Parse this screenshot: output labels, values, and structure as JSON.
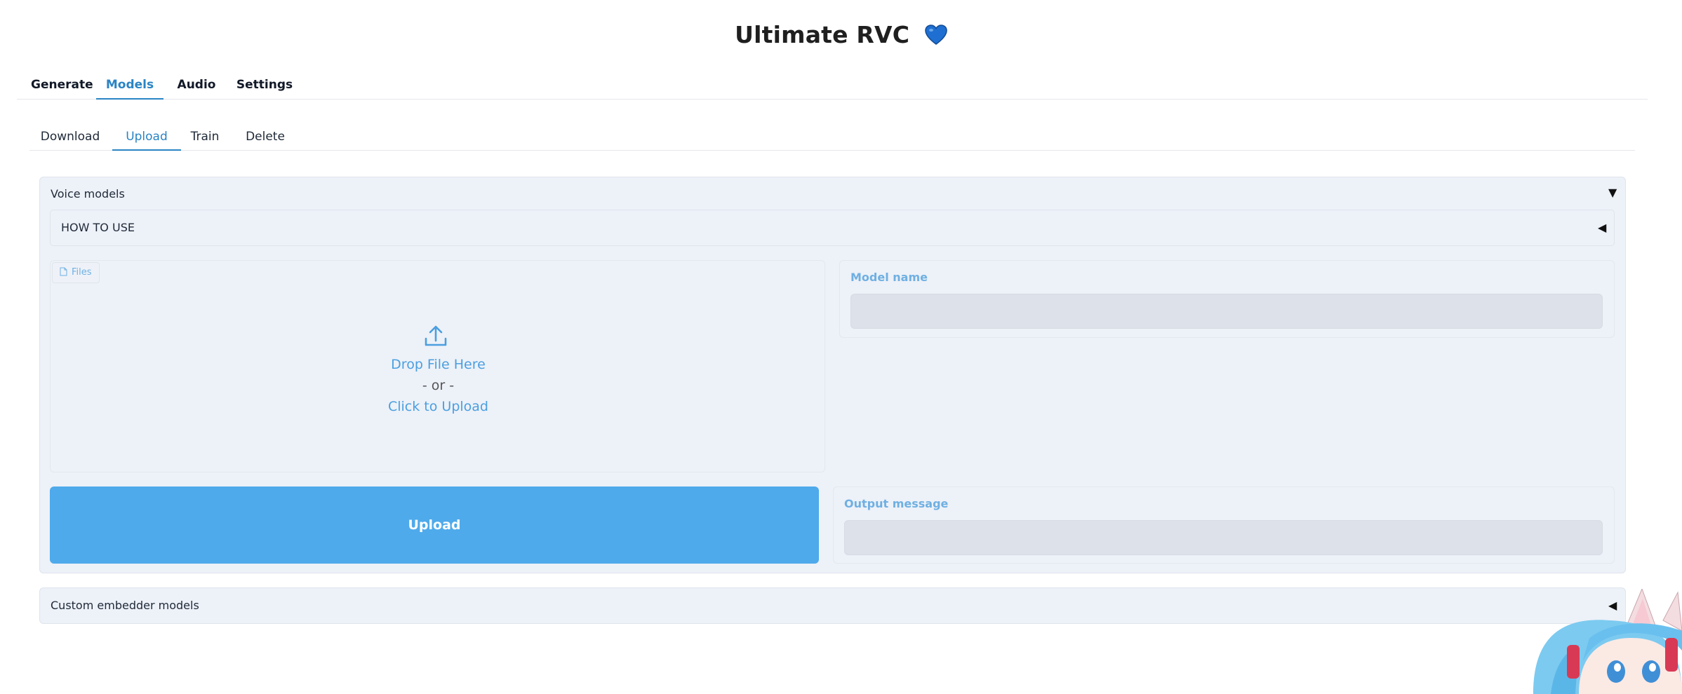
{
  "app": {
    "title": "Ultimate RVC",
    "title_emoji": "💙"
  },
  "main_tabs": [
    {
      "label": "Generate",
      "active": false
    },
    {
      "label": "Models",
      "active": true
    },
    {
      "label": "Audio",
      "active": false
    },
    {
      "label": "Settings",
      "active": false
    }
  ],
  "sub_tabs": [
    {
      "label": "Download",
      "active": false
    },
    {
      "label": "Upload",
      "active": true
    },
    {
      "label": "Train",
      "active": false
    },
    {
      "label": "Delete",
      "active": false
    }
  ],
  "voice_models": {
    "title": "Voice models",
    "expanded_arrow": "▼",
    "how_to_use": {
      "title": "HOW TO USE",
      "arrow": "◀"
    },
    "files": {
      "badge_label": "Files",
      "drop_text": "Drop File Here",
      "or_text": "- or -",
      "click_text": "Click to Upload"
    },
    "model_name": {
      "label": "Model name",
      "value": ""
    },
    "upload_button_label": "Upload",
    "output_message": {
      "label": "Output message",
      "value": ""
    }
  },
  "custom_embedder": {
    "title": "Custom embedder models",
    "arrow": "◀"
  },
  "colors": {
    "accent": "#2a84c4",
    "button": "#4eaaeb",
    "panel": "#edf1f8",
    "label": "#6fb0e2"
  },
  "icons": [
    "blue-heart-icon",
    "file-icon",
    "upload-icon",
    "collapse-arrow-icon",
    "expand-arrow-icon"
  ]
}
